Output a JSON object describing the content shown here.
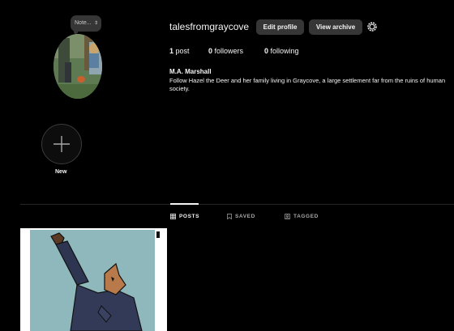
{
  "profile": {
    "username": "talesfromgraycove",
    "edit_profile_label": "Edit profile",
    "view_archive_label": "View archive",
    "note_label": "Note...",
    "full_name": "M.A. Marshall",
    "bio": "Follow Hazel the Deer and her family living in Graycove, a large settlement far from the ruins of human society."
  },
  "stats": {
    "posts_count": "1",
    "posts_label": "post",
    "followers_count": "0",
    "followers_label": "followers",
    "following_count": "0",
    "following_label": "following"
  },
  "highlights": {
    "new_label": "New"
  },
  "tabs": [
    {
      "label": "POSTS",
      "active": true,
      "icon": "grid-icon"
    },
    {
      "label": "SAVED",
      "active": false,
      "icon": "bookmark-icon"
    },
    {
      "label": "TAGGED",
      "active": false,
      "icon": "tag-icon"
    }
  ],
  "colors": {
    "background": "#000000",
    "button": "#363636",
    "text": "#f5f5f5",
    "muted": "#a8a8a8"
  }
}
